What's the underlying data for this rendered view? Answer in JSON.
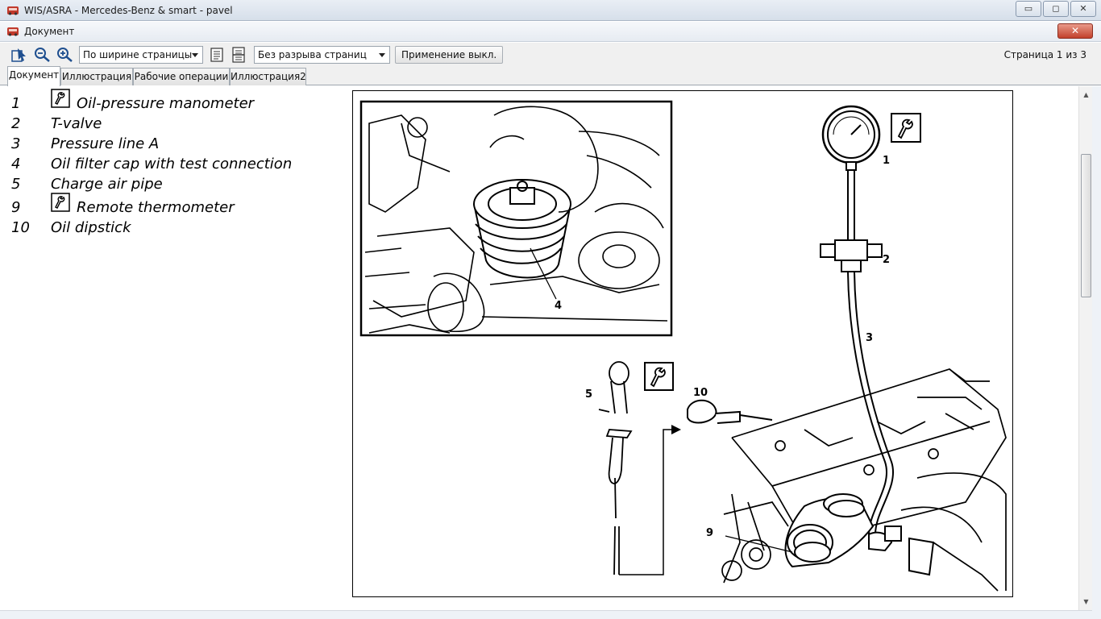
{
  "window": {
    "title": "WIS/ASRA - Mercedes-Benz & smart - pavel",
    "minimize_glyph": "▭",
    "restore_glyph": "◻",
    "close_glyph": "✕"
  },
  "document_window": {
    "title": "Документ",
    "close_glyph": "✕"
  },
  "toolbar": {
    "zoom_select": "По ширине страницы",
    "page_break_select": "Без разрыва страниц",
    "apply_button": "Применение выкл.",
    "page_indicator": "Страница 1 из 3"
  },
  "tabs": [
    {
      "label": "Документ",
      "active": true
    },
    {
      "label": "Иллюстрация",
      "active": false
    },
    {
      "label": "Рабочие операции",
      "active": false
    },
    {
      "label": "Иллюстрация2",
      "active": false
    }
  ],
  "legend": [
    {
      "num": "1",
      "text": "Oil-pressure manometer",
      "tool_icon": true
    },
    {
      "num": "2",
      "text": "T-valve",
      "tool_icon": false
    },
    {
      "num": "3",
      "text": "Pressure line A",
      "tool_icon": false
    },
    {
      "num": "4",
      "text": "Oil filter cap with test connection",
      "tool_icon": false
    },
    {
      "num": "5",
      "text": "Charge air pipe",
      "tool_icon": false
    },
    {
      "num": "9",
      "text": "Remote thermometer",
      "tool_icon": true
    },
    {
      "num": "10",
      "text": "Oil dipstick",
      "tool_icon": false
    }
  ],
  "figure": {
    "callouts": [
      "1",
      "2",
      "3",
      "4",
      "5",
      "9",
      "10"
    ]
  }
}
